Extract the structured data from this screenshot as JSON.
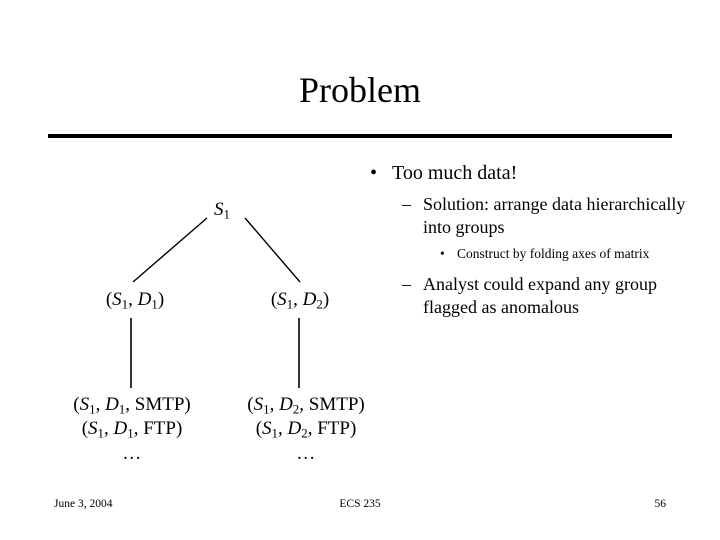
{
  "slide": {
    "title": "Problem",
    "rule_color": "#000000",
    "background": "#ffffff",
    "text_color": "#000000"
  },
  "tree": {
    "root": {
      "prefix": "",
      "var1": "S",
      "sub1": "1",
      "suffix": ""
    },
    "children": [
      {
        "open": "(",
        "var1": "S",
        "sub1": "1",
        "sep": ", ",
        "var2": "D",
        "sub2": "1",
        "close": ")"
      },
      {
        "open": "(",
        "var1": "S",
        "sub1": "1",
        "sep": ", ",
        "var2": "D",
        "sub2": "2",
        "close": ")"
      }
    ],
    "leaves": [
      {
        "lines": [
          {
            "open": "(",
            "var1": "S",
            "sub1": "1",
            "sep1": ", ",
            "var2": "D",
            "sub2": "1",
            "sep2": ", ",
            "proto": "SMTP",
            "close": ")"
          },
          {
            "open": "(",
            "var1": "S",
            "sub1": "1",
            "sep1": ", ",
            "var2": "D",
            "sub2": "1",
            "sep2": ", ",
            "proto": "FTP",
            "close": ")"
          }
        ],
        "ellipsis": "…"
      },
      {
        "lines": [
          {
            "open": "(",
            "var1": "S",
            "sub1": "1",
            "sep1": ", ",
            "var2": "D",
            "sub2": "2",
            "sep2": ", ",
            "proto": "SMTP",
            "close": ")"
          },
          {
            "open": "(",
            "var1": "S",
            "sub1": "1",
            "sep1": ", ",
            "var2": "D",
            "sub2": "2",
            "sep2": ", ",
            "proto": "FTP",
            "close": ")"
          }
        ],
        "ellipsis": "…"
      }
    ]
  },
  "bullets": {
    "level1_mark": "•",
    "level2_mark": "–",
    "level3_mark": "•",
    "items": [
      {
        "level": 1,
        "text": "Too much data!"
      },
      {
        "level": 2,
        "text": "Solution: arrange data hierarchically into groups"
      },
      {
        "level": 3,
        "text": "Construct by folding axes of matrix"
      },
      {
        "level": 2,
        "text": "Analyst could expand any group flagged as anomalous"
      }
    ]
  },
  "footer": {
    "date": "June 3, 2004",
    "course": "ECS 235",
    "page_number": "56"
  }
}
